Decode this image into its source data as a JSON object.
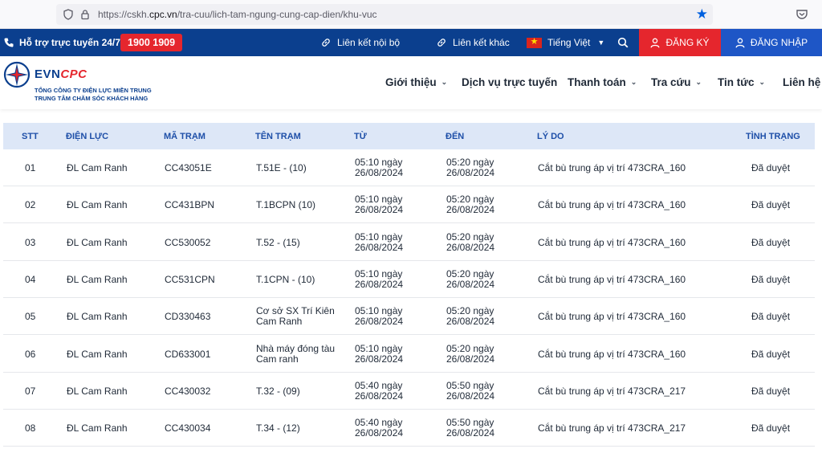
{
  "browser": {
    "url_prefix": "https://cskh.",
    "url_domain": "cpc.vn",
    "url_path": "/tra-cuu/lich-tam-ngung-cung-cap-dien/khu-vuc"
  },
  "topbar": {
    "support_label": "Hỗ trợ trực tuyến 24/7:",
    "hotline": "1900 1909",
    "internal_links": "Liên kết nội bộ",
    "other_links": "Liên kết khác",
    "language": "Tiếng Việt",
    "register": "ĐĂNG KÝ",
    "login": "ĐĂNG NHẬP"
  },
  "logo": {
    "evn": "EVN",
    "cpc": "CPC",
    "line1": "TỔNG CÔNG TY ĐIỆN LỰC MIỀN TRUNG",
    "line2": "TRUNG TÂM CHĂM SÓC KHÁCH HÀNG"
  },
  "nav": {
    "about": "Giới thiệu",
    "online_services": "Dịch vụ trực tuyến",
    "payment": "Thanh toán",
    "lookup": "Tra cứu",
    "news": "Tin tức",
    "contact": "Liên hệ"
  },
  "table": {
    "headers": [
      "STT",
      "ĐIỆN LỰC",
      "MÃ TRẠM",
      "TÊN TRẠM",
      "TỪ",
      "ĐẾN",
      "LÝ DO",
      "TÌNH TRẠNG"
    ],
    "rows": [
      {
        "stt": "01",
        "dien_luc": "ĐL Cam Ranh",
        "ma_tram": "CC43051E",
        "ten_tram": [
          "T.51E - (10)"
        ],
        "tu": [
          "05:10 ngày",
          "26/08/2024"
        ],
        "den": [
          "05:20 ngày",
          "26/08/2024"
        ],
        "ly_do": "Cắt bù trung áp vị trí 473CRA_160",
        "tinh_trang": "Đã duyệt"
      },
      {
        "stt": "02",
        "dien_luc": "ĐL Cam Ranh",
        "ma_tram": "CC431BPN",
        "ten_tram": [
          "T.1BCPN (10)"
        ],
        "tu": [
          "05:10 ngày",
          "26/08/2024"
        ],
        "den": [
          "05:20 ngày",
          "26/08/2024"
        ],
        "ly_do": "Cắt bù trung áp vị trí 473CRA_160",
        "tinh_trang": "Đã duyệt"
      },
      {
        "stt": "03",
        "dien_luc": "ĐL Cam Ranh",
        "ma_tram": "CC530052",
        "ten_tram": [
          "T.52 - (15)"
        ],
        "tu": [
          "05:10 ngày",
          "26/08/2024"
        ],
        "den": [
          "05:20 ngày",
          "26/08/2024"
        ],
        "ly_do": "Cắt bù trung áp vị trí 473CRA_160",
        "tinh_trang": "Đã duyệt"
      },
      {
        "stt": "04",
        "dien_luc": "ĐL Cam Ranh",
        "ma_tram": "CC531CPN",
        "ten_tram": [
          "T.1CPN - (10)"
        ],
        "tu": [
          "05:10 ngày",
          "26/08/2024"
        ],
        "den": [
          "05:20 ngày",
          "26/08/2024"
        ],
        "ly_do": "Cắt bù trung áp vị trí 473CRA_160",
        "tinh_trang": "Đã duyệt"
      },
      {
        "stt": "05",
        "dien_luc": "ĐL Cam Ranh",
        "ma_tram": "CD330463",
        "ten_tram": [
          "Cơ sở SX Trí Kiên",
          "Cam Ranh"
        ],
        "tu": [
          "05:10 ngày",
          "26/08/2024"
        ],
        "den": [
          "05:20 ngày",
          "26/08/2024"
        ],
        "ly_do": "Cắt bù trung áp vị trí 473CRA_160",
        "tinh_trang": "Đã duyệt"
      },
      {
        "stt": "06",
        "dien_luc": "ĐL Cam Ranh",
        "ma_tram": "CD633001",
        "ten_tram": [
          "Nhà máy đóng tàu",
          "Cam ranh"
        ],
        "tu": [
          "05:10 ngày",
          "26/08/2024"
        ],
        "den": [
          "05:20 ngày",
          "26/08/2024"
        ],
        "ly_do": "Cắt bù trung áp vị trí 473CRA_160",
        "tinh_trang": "Đã duyệt"
      },
      {
        "stt": "07",
        "dien_luc": "ĐL Cam Ranh",
        "ma_tram": "CC430032",
        "ten_tram": [
          "T.32 - (09)"
        ],
        "tu": [
          "05:40 ngày",
          "26/08/2024"
        ],
        "den": [
          "05:50 ngày",
          "26/08/2024"
        ],
        "ly_do": "Cắt bù trung áp vị trí 473CRA_217",
        "tinh_trang": "Đã duyệt"
      },
      {
        "stt": "08",
        "dien_luc": "ĐL Cam Ranh",
        "ma_tram": "CC430034",
        "ten_tram": [
          "T.34 - (12)"
        ],
        "tu": [
          "05:40 ngày",
          "26/08/2024"
        ],
        "den": [
          "05:50 ngày",
          "26/08/2024"
        ],
        "ly_do": "Cắt bù trung áp vị trí 473CRA_217",
        "tinh_trang": "Đã duyệt"
      }
    ]
  },
  "colors": {
    "primary_blue": "#0b3f8e",
    "accent_red": "#e5262d",
    "login_blue": "#1e56c6",
    "header_row_bg": "#dde7f7"
  }
}
